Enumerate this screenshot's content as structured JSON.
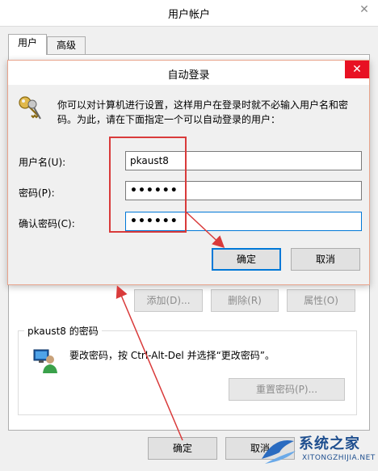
{
  "outer_window": {
    "title": "用户帐户",
    "close_glyph": "✕",
    "tabs": [
      {
        "label": "用户",
        "active": true
      },
      {
        "label": "高级",
        "active": false
      }
    ],
    "buttons": {
      "add": "添加(D)...",
      "delete": "删除(R)",
      "properties": "属性(O)"
    },
    "password_group": {
      "title": "pkaust8 的密码",
      "text": "要改密码，按 Ctrl-Alt-Del 并选择“更改密码”。",
      "reset_button": "重置密码(P)..."
    },
    "ok_button": "确定",
    "cancel_button": "取消"
  },
  "dialog": {
    "title": "自动登录",
    "close_glyph": "✕",
    "description": "你可以对计算机进行设置，这样用户在登录时就不必输入用户名和密码。为此，请在下面指定一个可以自动登录的用户：",
    "fields": {
      "username_label": "用户名(U):",
      "username_value": "pkaust8",
      "password_label": "密码(P):",
      "password_value": "••••••",
      "confirm_label": "确认密码(C):",
      "confirm_value": "••••••"
    },
    "ok_button": "确定",
    "cancel_button": "取消"
  },
  "watermark": {
    "text": "系统之家",
    "sub": "XITONGZHIJIA.NET"
  },
  "colors": {
    "annotation_red": "#d93a3a",
    "focus_blue": "#0078d7",
    "close_red": "#e81123"
  }
}
